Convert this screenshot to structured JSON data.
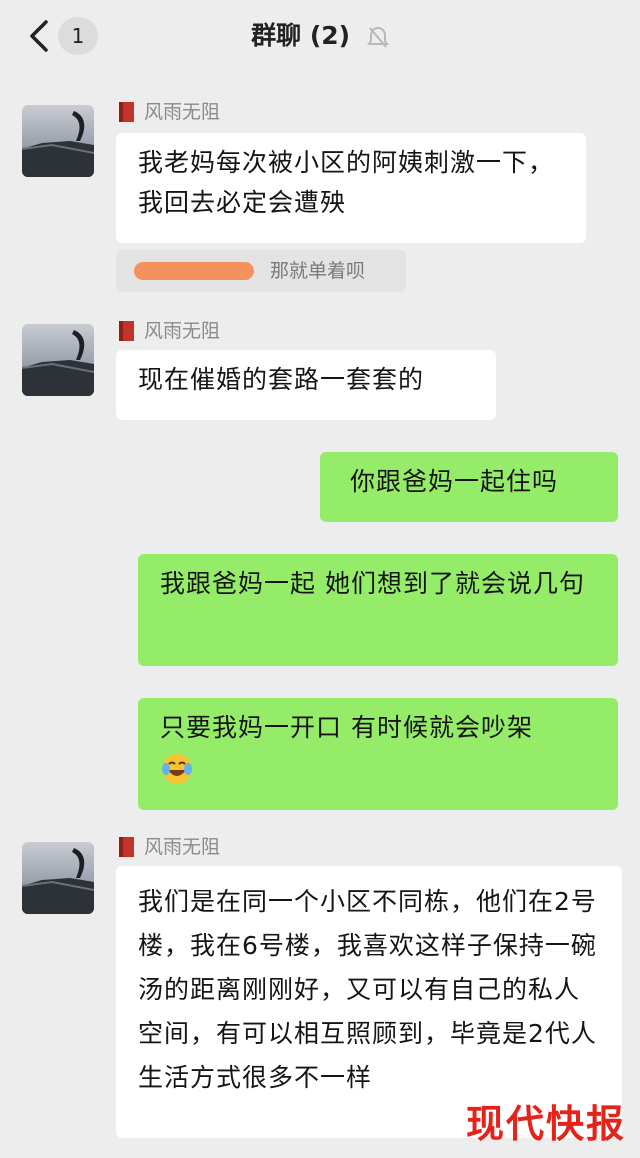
{
  "header": {
    "unread_count": "1",
    "title": "群聊 (2)"
  },
  "messages": [
    {
      "sender": "风雨无阻",
      "text": "我老妈每次被小区的阿姨刺激一下，我回去必定会遭殃"
    },
    {
      "quote_text": "那就单着呗"
    },
    {
      "sender": "风雨无阻",
      "text": "现在催婚的套路一套套的"
    },
    {
      "text": "你跟爸妈一起住吗"
    },
    {
      "text": "我跟爸妈一起 她们想到了就会说几句"
    },
    {
      "text": "只要我妈一开口 有时候就会吵架",
      "emoji": "face-with-tears-of-joy-icon"
    },
    {
      "sender": "风雨无阻",
      "text": "我们是在同一个小区不同栋，他们在2号楼，我在6号楼，我喜欢这样子保持一碗汤的距离刚刚好，又可以有自己的私人空间，有可以相互照顾到，毕竟是2代人生活方式很多不一样"
    }
  ],
  "watermark": "现代快报",
  "colors": {
    "background": "#ededed",
    "bubble_self": "#95ec69",
    "bubble_other": "#ffffff",
    "watermark": "#e4231b"
  }
}
